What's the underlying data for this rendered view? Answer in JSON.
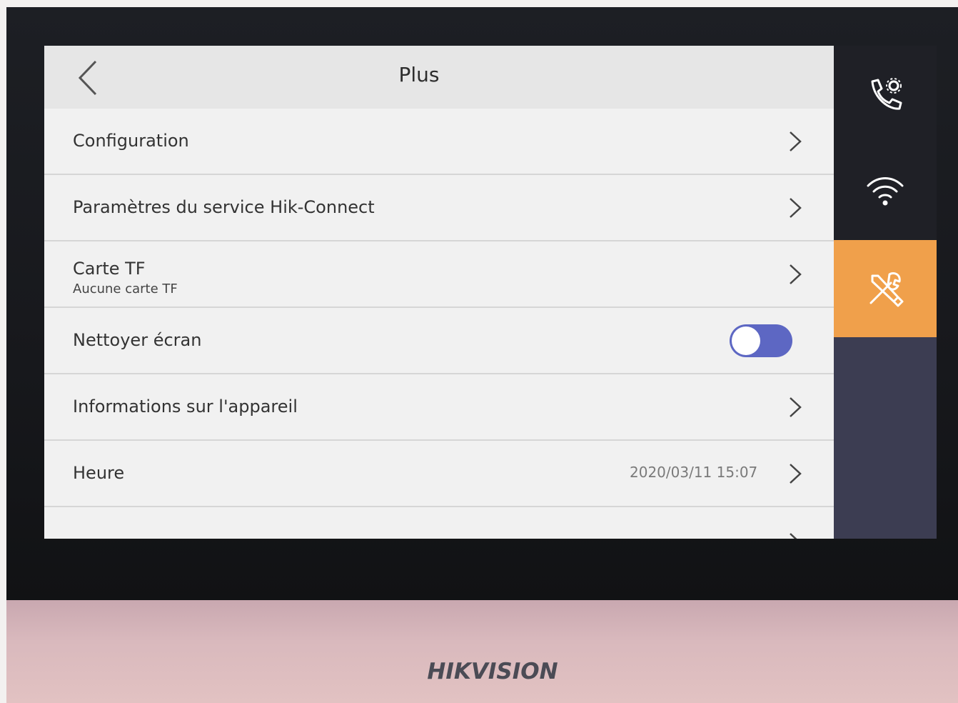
{
  "header": {
    "title": "Plus"
  },
  "menu": {
    "items": [
      {
        "label": "Configuration"
      },
      {
        "label": "Paramètres du service Hik-Connect"
      },
      {
        "label": "Carte TF",
        "sublabel": "Aucune carte TF"
      },
      {
        "label": "Nettoyer écran",
        "toggle_on": false
      },
      {
        "label": "Informations sur l'appareil"
      },
      {
        "label": "Heure",
        "value": "2020/03/11  15:07"
      }
    ]
  },
  "sidebar": {
    "items": [
      {
        "icon": "phone-settings-icon",
        "active": false
      },
      {
        "icon": "wifi-icon",
        "active": false
      },
      {
        "icon": "tools-icon",
        "active": true
      }
    ]
  },
  "colors": {
    "accent": "#f0a04b",
    "toggle": "#5d67c3"
  },
  "device": {
    "brand": "HIKVISION"
  }
}
